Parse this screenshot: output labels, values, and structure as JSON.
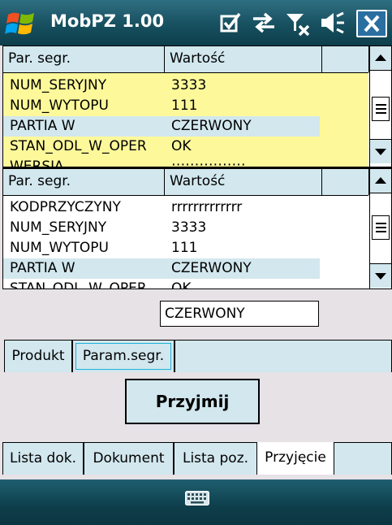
{
  "app": {
    "title": "MobPZ 1.00"
  },
  "title_icons": [
    "ok-check-icon",
    "data-connection-icon",
    "no-signal-icon",
    "volume-icon",
    "close-icon"
  ],
  "grid1": {
    "headers": [
      "Par. segr.",
      "Wartość"
    ],
    "rows": [
      {
        "name": "NUM_SERYJNY",
        "value": "3333"
      },
      {
        "name": "NUM_WYTOPU",
        "value": "111"
      },
      {
        "name": "PARTIA W",
        "value": "CZERWONY"
      },
      {
        "name": "STAN_ODL_W_OPER",
        "value": "OK"
      },
      {
        "name": "WERSJA",
        "value": "::::::::::::::::"
      }
    ],
    "selected_row": 2,
    "highlight_color": "#fdf99a"
  },
  "grid2": {
    "headers": [
      "Par. segr.",
      "Wartość"
    ],
    "rows": [
      {
        "name": "KODPRZYCZYNY",
        "value": "rrrrrrrrrrrrr"
      },
      {
        "name": "NUM_SERYJNY",
        "value": "3333"
      },
      {
        "name": "NUM_WYTOPU",
        "value": "111"
      },
      {
        "name": "PARTIA W",
        "value": "CZERWONY"
      },
      {
        "name": "STAN_ODL_W_OPER",
        "value": "OK"
      }
    ],
    "selected_row": 3
  },
  "value_field": {
    "value": "CZERWONY"
  },
  "inner_tabs": [
    {
      "label": "Produkt",
      "active": false
    },
    {
      "label": "Param.segr.",
      "active": true
    }
  ],
  "accept_button": {
    "label": "Przyjmij"
  },
  "main_tabs": [
    {
      "label": "Lista dok.",
      "active": false
    },
    {
      "label": "Dokument",
      "active": false
    },
    {
      "label": "Lista poz.",
      "active": false
    },
    {
      "label": "Przyjęcie",
      "active": true
    }
  ],
  "colors": {
    "header": "#d2e7ee",
    "selected": "#d2e7ee",
    "titlebar": "#17505f"
  }
}
